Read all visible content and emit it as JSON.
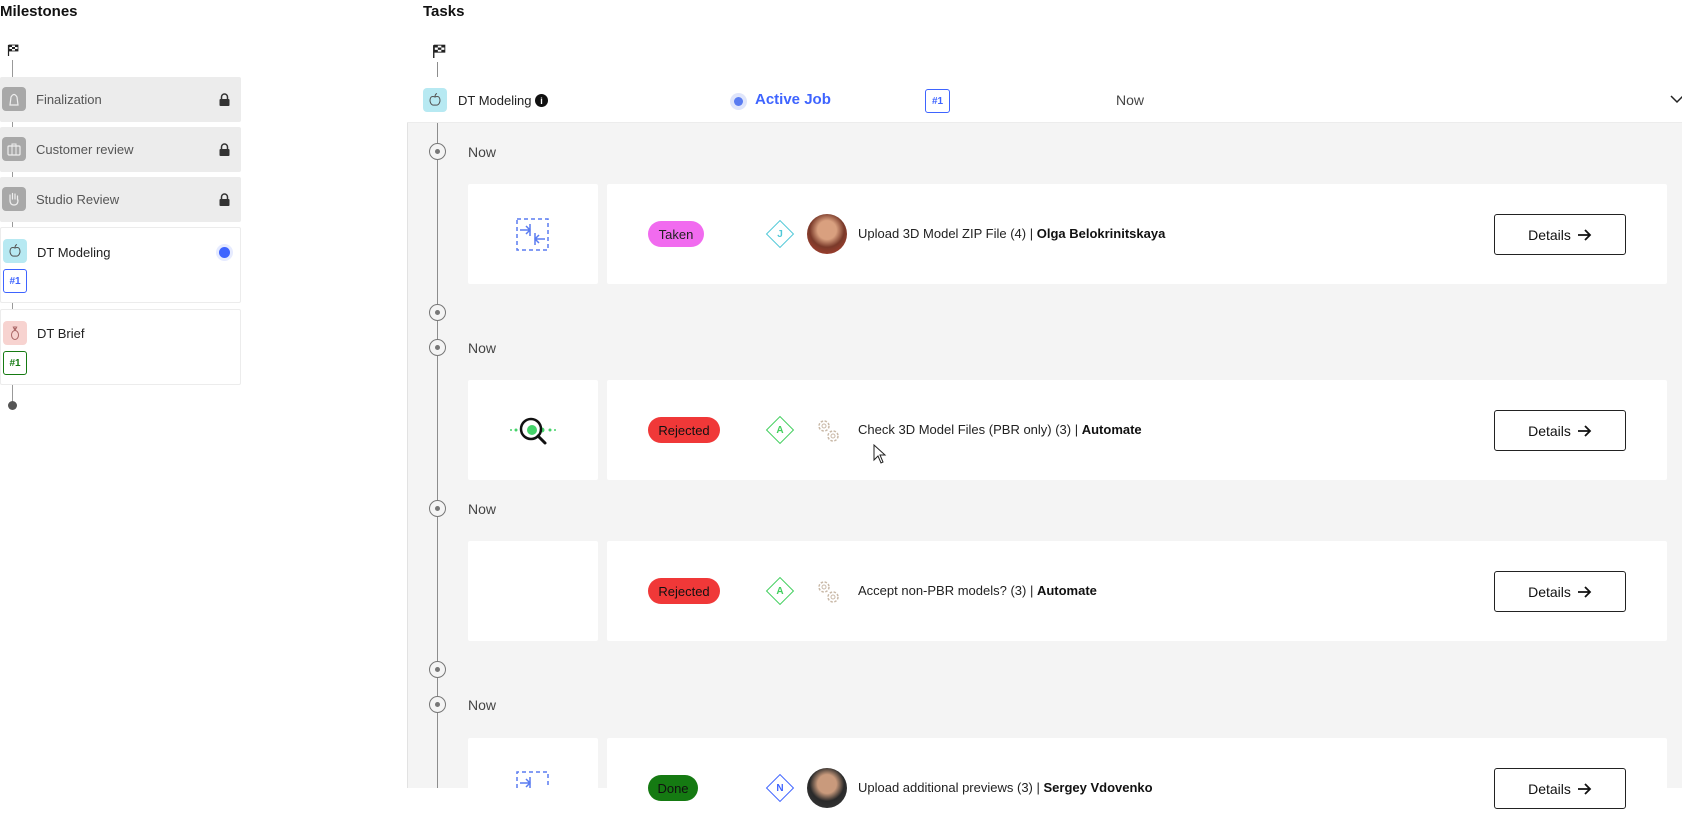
{
  "milestones": {
    "title": "Milestones",
    "items": [
      {
        "label": "Finalization",
        "state": "locked",
        "icon": "hand-bag-icon"
      },
      {
        "label": "Customer review",
        "state": "locked",
        "icon": "briefcase-icon"
      },
      {
        "label": "Studio Review",
        "state": "locked",
        "icon": "hand-icon"
      },
      {
        "label": "DT Modeling",
        "state": "active",
        "tag": "#1",
        "tag_color": "#3e64ff",
        "icon": "apple-icon"
      },
      {
        "label": "DT Brief",
        "state": "done",
        "tag": "#1",
        "tag_color": "#157a12",
        "icon": "pineapple-icon"
      }
    ]
  },
  "tasks": {
    "title": "Tasks",
    "job": {
      "name": "DT Modeling",
      "status": "Active Job",
      "tag": "#1",
      "time": "Now"
    },
    "items": [
      {
        "time": "Now",
        "status": "Taken",
        "assignee_letter": "J",
        "assignee_color": "#4fc8d8",
        "title": "Upload 3D Model ZIP File (4) | ",
        "owner": "Olga Belokrinitskaya",
        "icon": "upload-arrows-icon",
        "details": "Details"
      },
      {
        "time": "Now",
        "status": "Rejected",
        "assignee_letter": "A",
        "assignee_color": "#3fcf5c",
        "title": "Check 3D Model Files (PBR only) (3) | ",
        "owner": "Automate",
        "icon": "magnifier-icon",
        "details": "Details"
      },
      {
        "time": "Now",
        "status": "Rejected",
        "assignee_letter": "A",
        "assignee_color": "#3fcf5c",
        "title": "Accept non-PBR models? (3) | ",
        "owner": "Automate",
        "icon": "",
        "details": "Details"
      },
      {
        "time": "Now",
        "status": "Done",
        "assignee_letter": "N",
        "assignee_color": "#3e64ff",
        "title": "Upload additional previews (3) | ",
        "owner": "Sergey Vdovenko",
        "icon": "upload-arrows-icon",
        "details": "Details"
      }
    ]
  },
  "colors": {
    "accent": "#3e64ff",
    "taken": "#f16bef",
    "rejected": "#f03838",
    "done": "#157a12"
  }
}
